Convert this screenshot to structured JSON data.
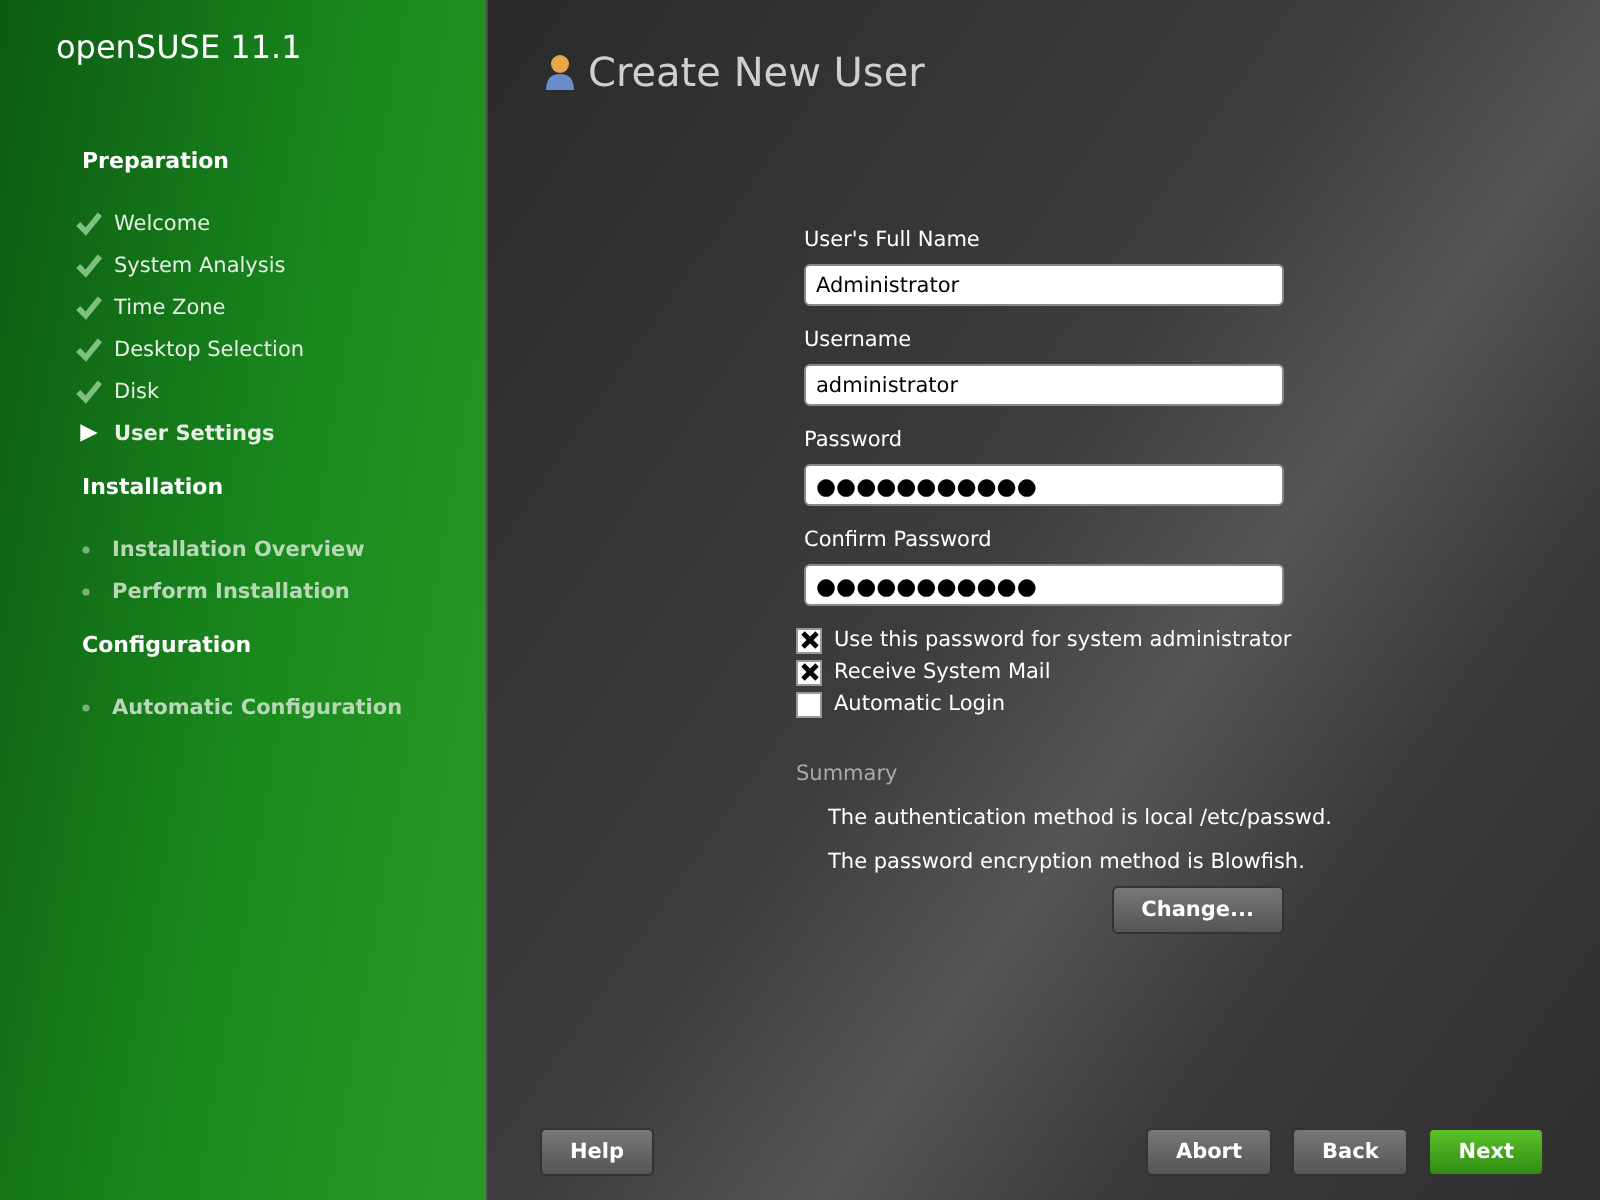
{
  "sidebar": {
    "logo": "openSUSE 11.1",
    "sections": [
      {
        "title": "Preparation",
        "items": [
          {
            "label": "Welcome",
            "kind": "done"
          },
          {
            "label": "System Analysis",
            "kind": "done"
          },
          {
            "label": "Time Zone",
            "kind": "done"
          },
          {
            "label": "Desktop Selection",
            "kind": "done"
          },
          {
            "label": "Disk",
            "kind": "done"
          },
          {
            "label": "User Settings",
            "kind": "current"
          }
        ]
      },
      {
        "title": "Installation",
        "items": [
          {
            "label": "Installation Overview",
            "kind": "pending"
          },
          {
            "label": "Perform Installation",
            "kind": "pending"
          }
        ]
      },
      {
        "title": "Configuration",
        "items": [
          {
            "label": "Automatic Configuration",
            "kind": "pending"
          }
        ]
      }
    ]
  },
  "page": {
    "title": "Create New User",
    "fields": [
      {
        "label": "User's Full Name",
        "value": "Administrator",
        "kind": "text"
      },
      {
        "label": "Username",
        "value": "administrator",
        "kind": "text"
      },
      {
        "label": "Password",
        "value": "●●●●●●●●●●●",
        "kind": "password"
      },
      {
        "label": "Confirm Password",
        "value": "●●●●●●●●●●●",
        "kind": "password"
      }
    ],
    "checkboxes": [
      {
        "label": "Use this password for system administrator",
        "checked": true
      },
      {
        "label": "Receive System Mail",
        "checked": true
      },
      {
        "label": "Automatic Login",
        "checked": false
      }
    ],
    "summary": {
      "title": "Summary",
      "lines": [
        "The authentication method is local /etc/passwd.",
        "The password encryption method is Blowfish."
      ],
      "button": "Change..."
    }
  },
  "buttons": [
    {
      "label": "Help",
      "kind": "normal"
    },
    {
      "label": "Abort",
      "kind": "normal"
    },
    {
      "label": "Back",
      "kind": "normal"
    },
    {
      "label": "Next",
      "kind": "primary"
    }
  ]
}
